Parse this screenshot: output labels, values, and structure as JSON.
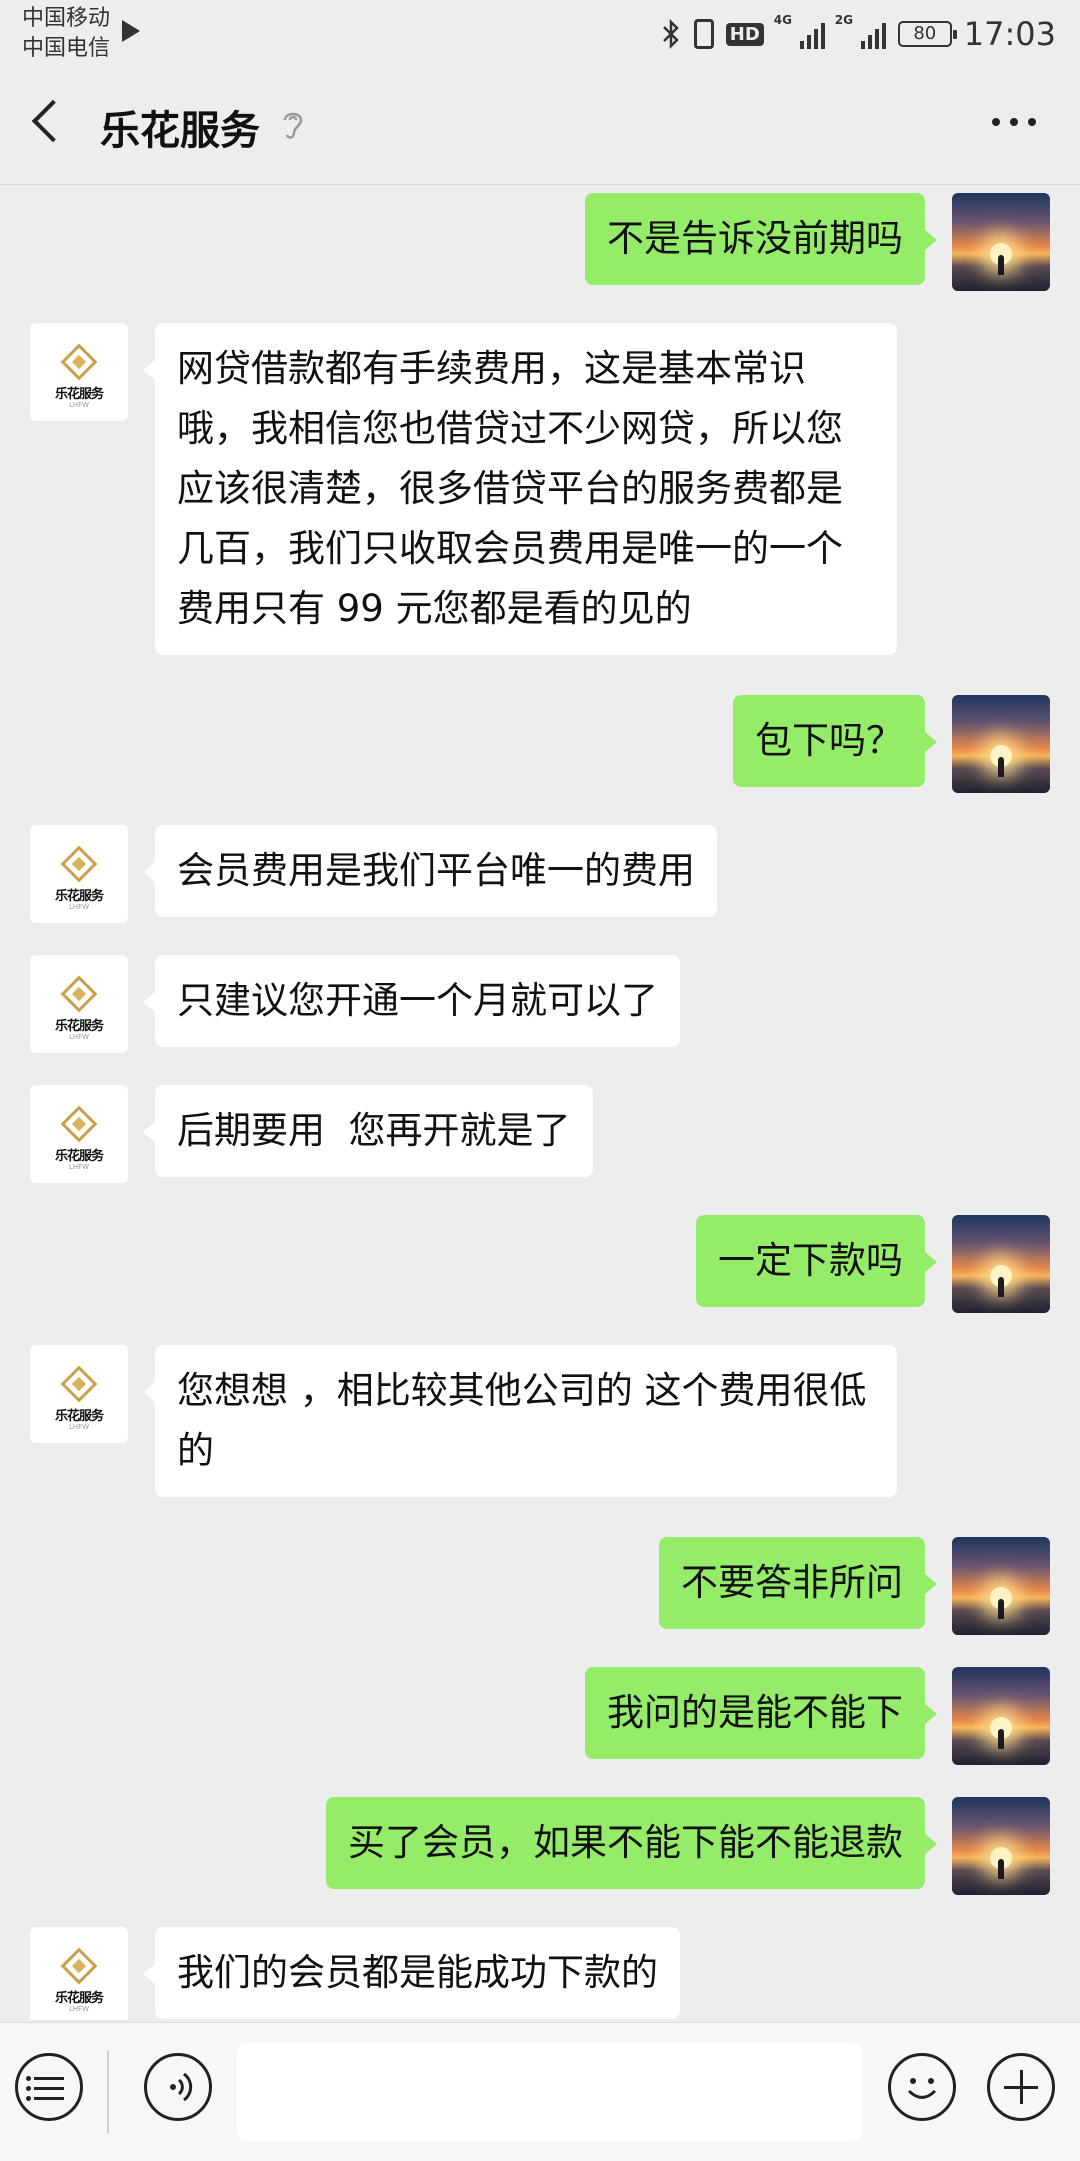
{
  "status_bar": {
    "carrier_1": "中国移动",
    "carrier_2": "中国电信",
    "signal_1_tag": "4G",
    "signal_2_tag": "2G",
    "hd_label": "HD",
    "battery": "80",
    "time": "17:03"
  },
  "header": {
    "title": "乐花服务"
  },
  "bot_avatar": {
    "logo_text": "乐花服务",
    "logo_sub": "LHFW"
  },
  "messages": [
    {
      "sender": "me",
      "text": "不是告诉没前期吗"
    },
    {
      "sender": "bot",
      "text": "网贷借款都有手续费用，这是基本常识哦，我相信您也借贷过不少网贷，所以您应该很清楚，很多借贷平台的服务费都是几百，我们只收取会员费用是唯一的一个费用只有 99 元您都是看的见的"
    },
    {
      "sender": "me",
      "text": "包下吗？"
    },
    {
      "sender": "bot",
      "text": "会员费用是我们平台唯一的费用"
    },
    {
      "sender": "bot",
      "text": "只建议您开通一个月就可以了"
    },
    {
      "sender": "bot",
      "text": "后期要用  您再开就是了"
    },
    {
      "sender": "me",
      "text": "一定下款吗"
    },
    {
      "sender": "bot",
      "text": "您想想 ，相比较其他公司的 这个费用很低的"
    },
    {
      "sender": "me",
      "text": "不要答非所问"
    },
    {
      "sender": "me",
      "text": "我问的是能不能下"
    },
    {
      "sender": "me",
      "text": "买了会员，如果不能下能不能退款"
    },
    {
      "sender": "bot",
      "text": "我们的会员都是能成功下款的"
    }
  ],
  "input_bar": {
    "text_value": ""
  },
  "icons": {
    "back": "back-arrow-icon",
    "ear": "ear-icon",
    "more": "more-icon",
    "menu": "menu-icon",
    "voice": "voice-icon",
    "emoji": "emoji-icon",
    "plus": "plus-icon"
  },
  "colors": {
    "my_bubble": "#95ec69",
    "bot_bubble": "#ffffff",
    "background": "#ededed"
  }
}
